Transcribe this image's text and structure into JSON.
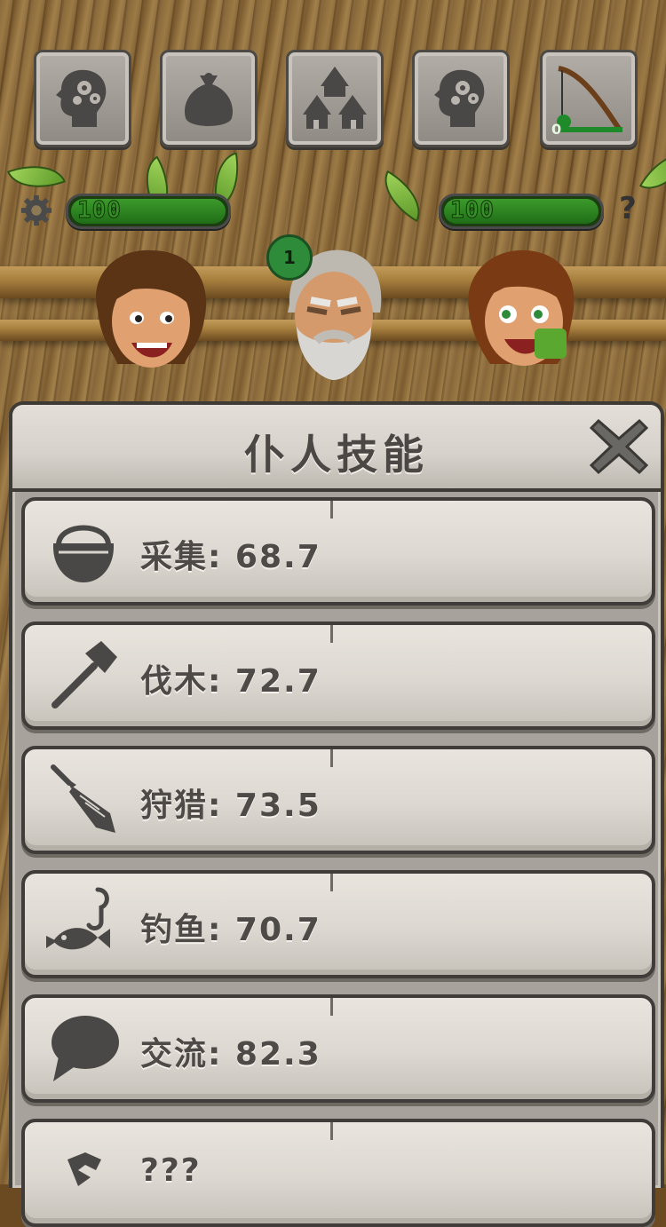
{
  "top_icons": [
    {
      "name": "brain-gears-icon"
    },
    {
      "name": "sack-icon"
    },
    {
      "name": "huts-icon"
    },
    {
      "name": "brain-gears-icon"
    },
    {
      "name": "fishing-rod-icon",
      "badge": "0"
    }
  ],
  "bars": [
    {
      "value_text": "100",
      "percent": 100
    },
    {
      "value_text": "100",
      "percent": 100
    }
  ],
  "level_badge": "1",
  "help_label": "?",
  "modal": {
    "title": "仆人技能",
    "skills": [
      {
        "icon": "basket-icon",
        "label": "采集: 68.7"
      },
      {
        "icon": "axe-icon",
        "label": "伐木: 72.7"
      },
      {
        "icon": "spear-icon",
        "label": "狩猎: 73.5"
      },
      {
        "icon": "fish-hook-icon",
        "label": "钓鱼: 70.7"
      },
      {
        "icon": "speech-bubble-icon",
        "label": "交流: 82.3"
      },
      {
        "icon": "unknown-icon",
        "label": "???"
      }
    ]
  },
  "colors": {
    "stone_light": "#e9e5de",
    "stone_dark": "#3f3c39",
    "bar_green": "#2e8b2a",
    "text_gray": "#4d4a47"
  }
}
